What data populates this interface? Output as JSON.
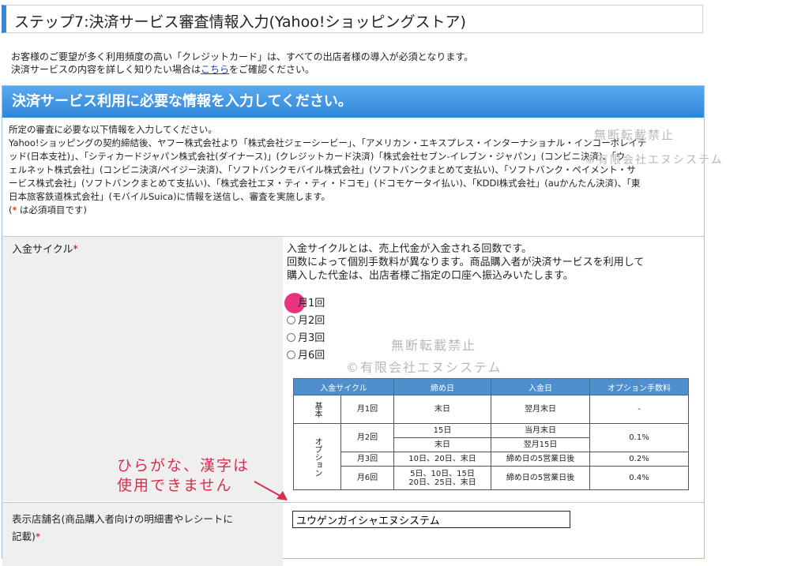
{
  "step": {
    "title": "ステップ7:決済サービス審査情報入力(Yahoo!ショッピングストア)"
  },
  "intro": {
    "line1": "お客様のご要望が多く利用頻度の高い「クレジットカード」は、すべての出店者様の導入が必須となります。",
    "line2_prefix": "決済サービスの内容を詳しく知りたい場合は",
    "link": "こちら",
    "line2_suffix": "をご確認ください。"
  },
  "section": {
    "header": "決済サービス利用に必要な情報を入力してください。",
    "desc_lines": [
      "所定の審査に必要な以下情報を入力してください。",
      "Yahoo!ショッピングの契約締結後、ヤフー株式会社より「株式会社ジェーシービー」、「アメリカン・エキスプレス・インターナショナル・インコーポレイテ",
      "ッド(日本支社)」、「シティカードジャパン株式会社(ダイナース)」(クレジットカード決済)「株式会社セブン-イレブン・ジャパン」(コンビニ決済)、「ウ",
      "ェルネット株式会社」(コンビニ決済/ペイジー決済)、「ソフトバンクモバイル株式会社」(ソフトバンクまとめて支払い)、「ソフトバンク・ペイメント・サ",
      "ービス株式会社」(ソフトバンクまとめて支払い)、「株式会社エヌ・ティ・ティ・ドコモ」(ドコモケータイ払い)、「KDDI株式会社」(auかんたん決済)、「東",
      "日本旅客鉄道株式会社」(モバイルSuica)に情報を送信し、審査を実施します。"
    ],
    "required_note_open": "(",
    "required_star": "*",
    "required_note_rest": " は必須項目です)"
  },
  "cycle": {
    "label": "入金サイクル",
    "star": "*",
    "desc": [
      "入金サイクルとは、売上代金が入金される回数です。",
      "回数によって個別手数料が異なります。商品購入者が決済サービスを利用して",
      "購入した代金は、出店者様ご指定の口座へ振込みいたします。"
    ],
    "options": [
      "月1回",
      "月2回",
      "月3回",
      "月6回"
    ],
    "selected": "月1回"
  },
  "fee_table": {
    "headers": [
      "入金サイクル",
      "締め日",
      "入金日",
      "オプション手数料"
    ],
    "basic_label": "基本",
    "option_label": "オプション",
    "rows": {
      "m1": {
        "cycle": "月1回",
        "close": "末日",
        "pay": "翌月末日",
        "fee": "-"
      },
      "m2": {
        "cycle": "月2回",
        "close_a": "15日",
        "pay_a": "当月末日",
        "close_b": "末日",
        "pay_b": "翌月15日",
        "fee": "0.1%"
      },
      "m3": {
        "cycle": "月3回",
        "close": "10日、20日、末日",
        "pay": "締め日の5営業日後",
        "fee": "0.2%"
      },
      "m6": {
        "cycle": "月6回",
        "close_1": "5日、10日、15日",
        "close_2": "20日、25日、末日",
        "pay": "締め日の5営業日後",
        "fee": "0.4%"
      }
    }
  },
  "watermark": {
    "text1": "無断転載禁止",
    "text2": "©有限会社エヌシステム"
  },
  "annotation": {
    "line1": "ひらがな、漢字は",
    "line2": "使用できません"
  },
  "shop_name": {
    "label_line1": "表示店舗名(商品購入者向けの明細書やレシートに",
    "label_line2": "記載)",
    "star": "*",
    "value": "ユウゲンガイシャエヌシステム"
  }
}
